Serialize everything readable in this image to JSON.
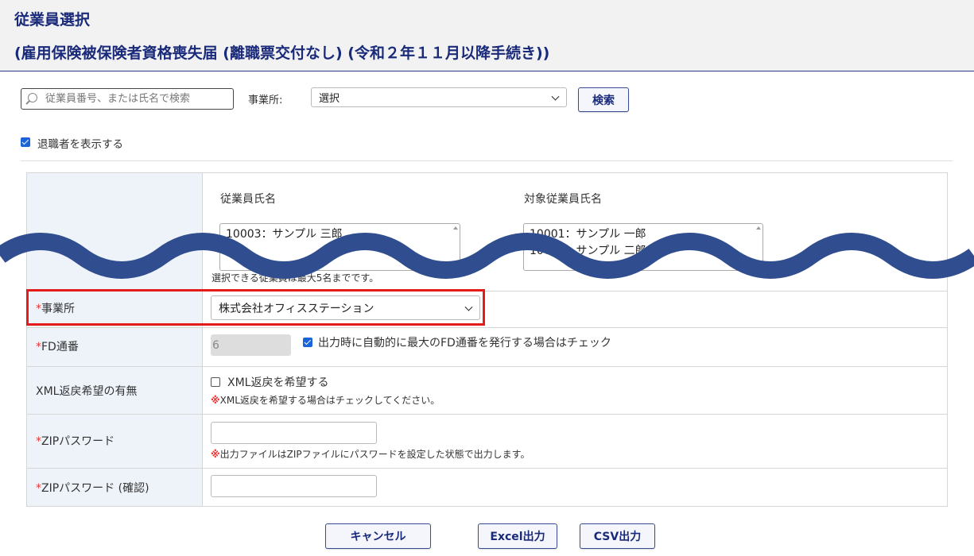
{
  "header": {
    "title": "従業員選択",
    "subtitle": "(雇用保険被保険者資格喪失届 (離職票交付なし) (令和２年１１月以降手続き))"
  },
  "search": {
    "placeholder": "従業員番号、または氏名で検索",
    "office_label": "事業所:",
    "office_value": "選択",
    "search_button": "検索"
  },
  "show_retired": {
    "checked": true,
    "label": "退職者を表示する"
  },
  "employee_select": {
    "left_header": "従業員氏名",
    "right_header": "対象従業員氏名",
    "left_items": [
      "10003：サンプル 三郎"
    ],
    "right_items": [
      "10001：サンプル 一郎",
      "10002：サンプル 二郎"
    ],
    "note": "選択できる従業員は最大5名までです。"
  },
  "form": {
    "office": {
      "required_mark": "*",
      "label": "事業所",
      "value": "株式会社オフィスステーション"
    },
    "fd_number": {
      "required_mark": "*",
      "label": "FD通番",
      "value": "6",
      "auto_checked": true,
      "auto_label": "出力時に自動的に最大のFD通番を発行する場合はチェック"
    },
    "xml_return": {
      "label": "XML返戻希望の有無",
      "checked": false,
      "checkbox_label": "XML返戻を希望する",
      "note_mark": "※",
      "note": "XML返戻を希望する場合はチェックしてください。"
    },
    "zip_password": {
      "required_mark": "*",
      "label": "ZIPパスワード",
      "value": "",
      "note_mark": "※",
      "note": "出力ファイルはZIPファイルにパスワードを設定した状態で出力します。"
    },
    "zip_password_confirm": {
      "required_mark": "*",
      "label": "ZIPパスワード (確認)",
      "value": ""
    }
  },
  "footer": {
    "cancel_button": "キャンセル",
    "excel_button": "Excel出力",
    "csv_button": "CSV出力"
  },
  "colors": {
    "accent": "#1a2a7a",
    "highlight": "#e31b1b",
    "wave": "#2f4d8f",
    "required": "#e33"
  }
}
